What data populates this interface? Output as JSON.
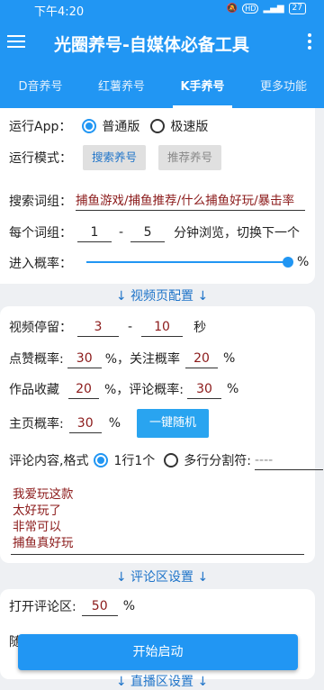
{
  "status": {
    "time": "下午4:20",
    "battery": "27"
  },
  "header": {
    "title": "光圈养号-自媒体必备工具"
  },
  "tabs": [
    {
      "label": "D音养号"
    },
    {
      "label": "红薯养号"
    },
    {
      "label": "K手养号"
    },
    {
      "label": "更多功能"
    }
  ],
  "run": {
    "app_label": "运行App：",
    "option_normal": "普通版",
    "option_fast": "极速版",
    "mode_label": "运行模式：",
    "search_btn": "搜索养号",
    "recommend_btn": "推荐养号"
  },
  "search": {
    "keywords_label": "搜索词组：",
    "keywords": "捕鱼游戏/捕鱼推荐/什么捕鱼好玩/暴击率",
    "per_label": "每个词组：",
    "min": "1",
    "dash": "-",
    "max": "5",
    "per_suffix": "分钟浏览，切换下一个",
    "enter_label": "进入概率：",
    "enter_value": 1.0,
    "percent": "%"
  },
  "video_section": "↓ 视频页配置 ↓",
  "video": {
    "stay_label": "视频停留：",
    "stay_min": "3",
    "stay_dash": "-",
    "stay_max": "10",
    "stay_unit": "秒",
    "like_label": "点赞概率:",
    "like_val": "30",
    "like_suffix": "%，关注概率",
    "follow_val": "20",
    "follow_suffix": "%",
    "fav_label": "作品收藏",
    "fav_val": "20",
    "fav_suffix": "%，评论概率:",
    "comment_val": "30",
    "comment_suffix": "%",
    "home_label": "主页概率:",
    "home_val": "30",
    "home_suffix": "%",
    "random_btn": "一键随机",
    "format_label": "评论内容,格式",
    "format_one": "1行1个",
    "format_multi": "多行分割符:",
    "separator": "----",
    "comments": [
      "我爱玩这款",
      "太好玩了",
      "非常可以",
      "捕鱼真好玩"
    ]
  },
  "comment_section": "↓ 评论区设置 ↓",
  "comment": {
    "open_label": "打开评论区:",
    "open_val": "50",
    "open_suffix": "%",
    "partial_label": "随"
  },
  "start_btn": "开始启动",
  "live_section": "↓ 直播区设置 ↓",
  "colors": {
    "primary": "#2196F3",
    "value": "#8b1a1a",
    "link": "#1f74c9"
  }
}
